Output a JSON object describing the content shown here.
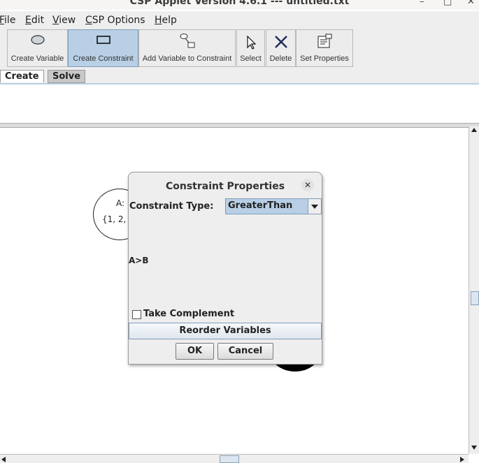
{
  "window": {
    "title": "CSP Applet Version 4.6.1 --- untitled.txt",
    "minimize": "–",
    "maximize": "□",
    "close": "✕"
  },
  "menu": [
    "File",
    "Edit",
    "View",
    "CSP Options",
    "Help"
  ],
  "toolbar": {
    "create_variable": "Create Variable",
    "create_constraint": "Create Constraint",
    "add_variable": "Add Variable to Constraint",
    "select": "Select",
    "delete": "Delete",
    "set_properties": "Set Properties"
  },
  "tabs": {
    "create": "Create",
    "solve": "Solve"
  },
  "canvas": {
    "variable_name": "A:",
    "variable_domain": "{1, 2,"
  },
  "dialog": {
    "title": "Constraint Properties",
    "close": "✕",
    "constraint_type_label": "Constraint Type:",
    "constraint_type_value": "GreaterThan",
    "expression": "A>B",
    "take_complement": "Take Complement",
    "reorder": "Reorder Variables",
    "ok": "OK",
    "cancel": "Cancel"
  },
  "colors": {
    "selected_tool": "#b8cfe5",
    "dialog_bg": "#eeeeee",
    "accent": "#7f9db9"
  }
}
